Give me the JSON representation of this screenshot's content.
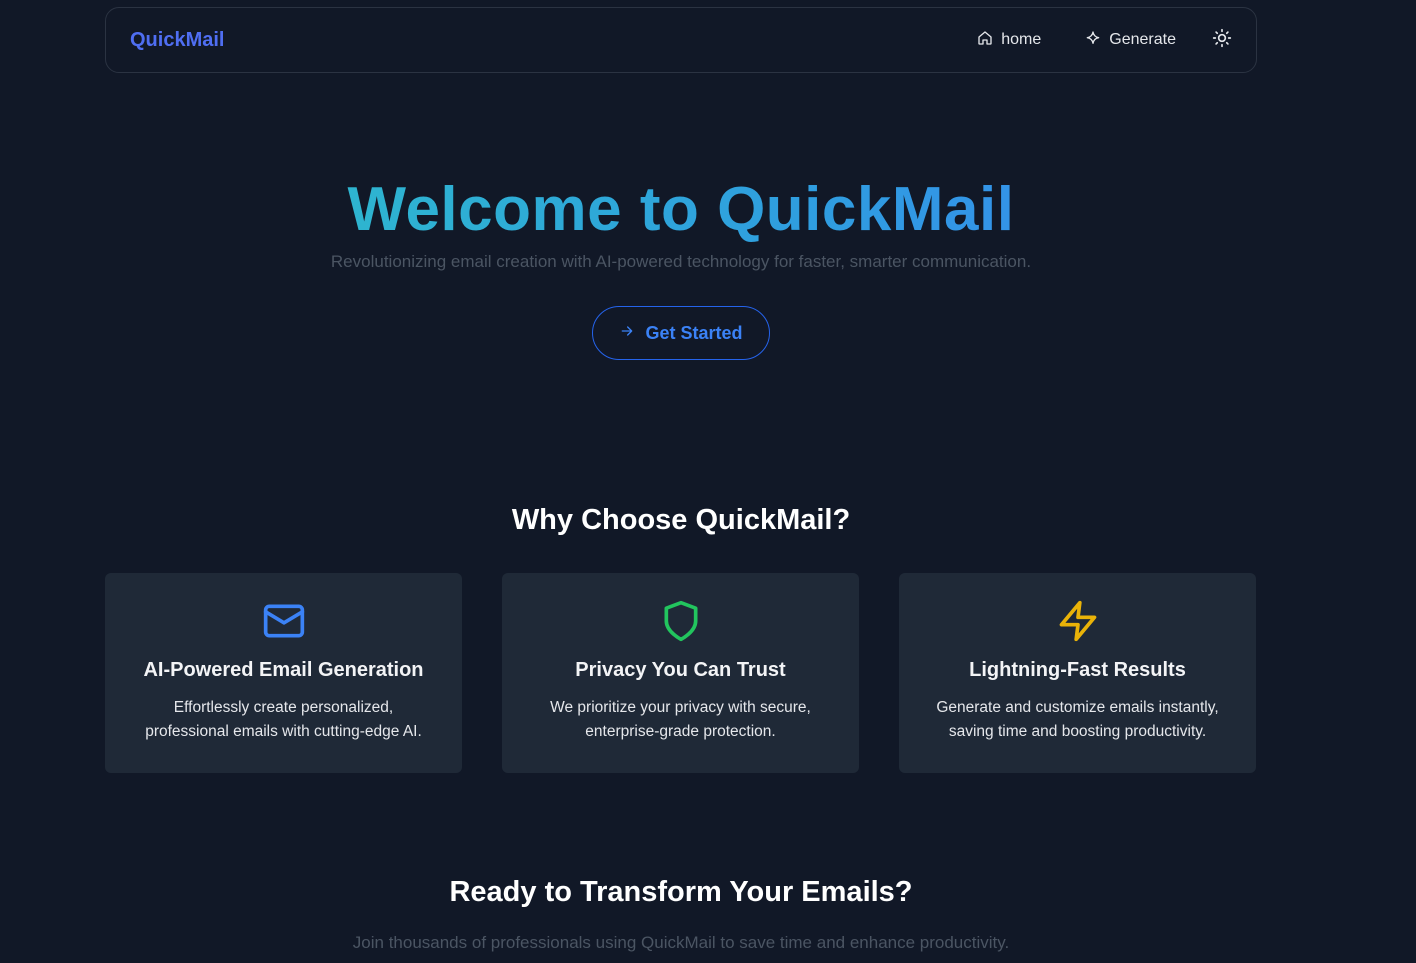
{
  "nav": {
    "brand": "QuickMail",
    "links": [
      {
        "label": "home",
        "icon": "home-icon"
      },
      {
        "label": "Generate",
        "icon": "sparkle-icon"
      }
    ],
    "theme_icon": "sun-icon"
  },
  "hero": {
    "title": "Welcome to QuickMail",
    "subtitle": "Revolutionizing email creation with AI-powered technology for faster, smarter communication.",
    "cta_label": "Get Started",
    "cta_icon": "arrow-right-icon"
  },
  "features": {
    "title": "Why Choose QuickMail?",
    "cards": [
      {
        "icon": "mail-icon",
        "icon_color": "#3b82f6",
        "title": "AI-Powered Email Generation",
        "description": "Effortlessly create personalized, professional emails with cutting-edge AI."
      },
      {
        "icon": "shield-icon",
        "icon_color": "#22c55e",
        "title": "Privacy You Can Trust",
        "description": "We prioritize your privacy with secure, enterprise-grade protection."
      },
      {
        "icon": "lightning-icon",
        "icon_color": "#eab308",
        "title": "Lightning-Fast Results",
        "description": "Generate and customize emails instantly, saving time and boosting productivity."
      }
    ]
  },
  "ready": {
    "title": "Ready to Transform Your Emails?",
    "subtitle": "Join thousands of professionals using QuickMail to save time and enhance productivity."
  },
  "colors": {
    "background": "#111827",
    "card": "#1f2937",
    "accent": "#3b82f6",
    "gradient_start": "#2dc6c4",
    "gradient_end": "#3b82f6"
  }
}
